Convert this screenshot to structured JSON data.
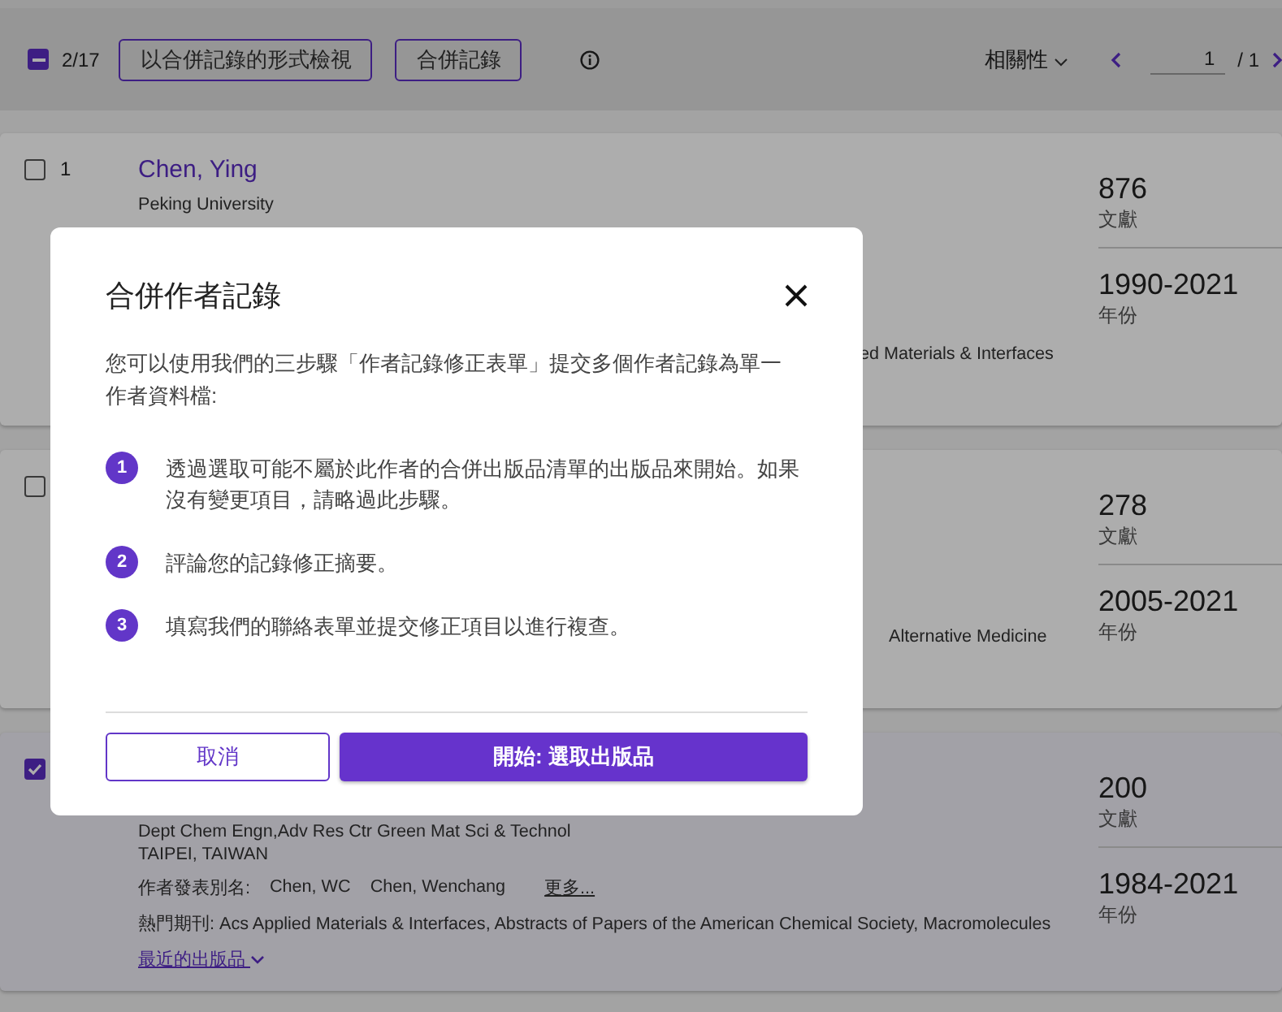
{
  "toolbar": {
    "select_all": {
      "indeterminate": true
    },
    "selected_count": "2/17",
    "buttons": [
      "以合併記錄的形式檢視",
      "合併記錄"
    ],
    "sort": "相關性",
    "page": "1",
    "page_total": "/ 1"
  },
  "records": [
    {
      "checked": false,
      "index": "1",
      "name": "Chen, Ying",
      "lines": [
        "Peking University"
      ],
      "journal_fragment": "ed Materials & Interfaces",
      "stats": [
        {
          "value": "876",
          "label": "文獻"
        },
        {
          "value": "1990-2021",
          "label": "年份"
        }
      ]
    },
    {
      "checked": false,
      "journal_fragment": "Alternative Medicine",
      "stats": [
        {
          "value": "278",
          "label": "文獻"
        },
        {
          "value": "2005-2021",
          "label": "年份"
        }
      ]
    },
    {
      "checked": true,
      "lines": [
        "Dept Chem Engn,Adv Res Ctr Green Mat Sci & Technol",
        "TAIPEI, TAIWAN"
      ],
      "aliases_label": "作者發表別名:",
      "aliases": [
        "Chen, WC",
        "Chen, Wenchang"
      ],
      "more": "更多...",
      "journals": "熱門期刊: Acs Applied Materials & Interfaces, Abstracts of Papers of the American Chemical Society, Macromolecules",
      "recent": "最近的出版品",
      "stats": [
        {
          "value": "200",
          "label": "文獻"
        },
        {
          "value": "1984-2021",
          "label": "年份"
        }
      ]
    }
  ],
  "modal": {
    "title": "合併作者記錄",
    "intro": "您可以使用我們的三步驟「作者記錄修正表單」提交多個作者記錄為單一作者資料檔:",
    "steps": [
      {
        "number": "1",
        "text": "透過選取可能不屬於此作者的合併出版品清單的出版品來開始。如果沒有變更項目，請略過此步驟。"
      },
      {
        "number": "2",
        "text": "評論您的記錄修正摘要。"
      },
      {
        "number": "3",
        "text": "填寫我們的聯絡表單並提交修正項目以進行複查。"
      }
    ],
    "cancel": "取消",
    "start": "開始: 選取出版品"
  }
}
